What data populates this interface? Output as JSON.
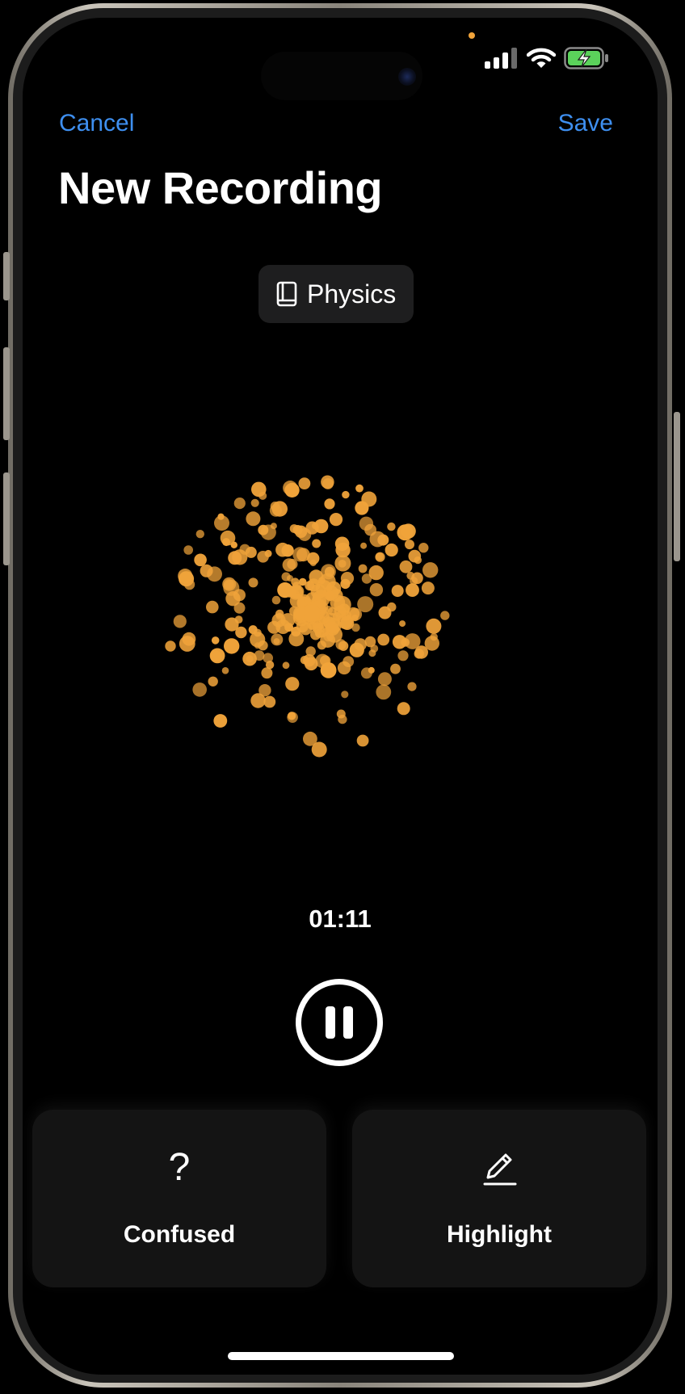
{
  "nav": {
    "cancel_label": "Cancel",
    "save_label": "Save"
  },
  "page": {
    "title": "New Recording"
  },
  "subject_chip": {
    "label": "Physics",
    "icon": "book-icon"
  },
  "recording": {
    "elapsed": "01:11",
    "control_icon": "pause-icon"
  },
  "actions": [
    {
      "label": "Confused",
      "icon": "question-mark-icon"
    },
    {
      "label": "Highlight",
      "icon": "pencil-underline-icon"
    }
  ],
  "status_bar": {
    "icons": [
      "cellular-signal-icon",
      "wifi-icon",
      "battery-charging-icon"
    ]
  },
  "colors": {
    "background": "#000000",
    "accent_blue": "#3E8FF0",
    "visualizer_orange": "#F0A33A",
    "card_background": "#141414",
    "chip_background": "#1E1E1F",
    "battery_green": "#5BD25B"
  }
}
